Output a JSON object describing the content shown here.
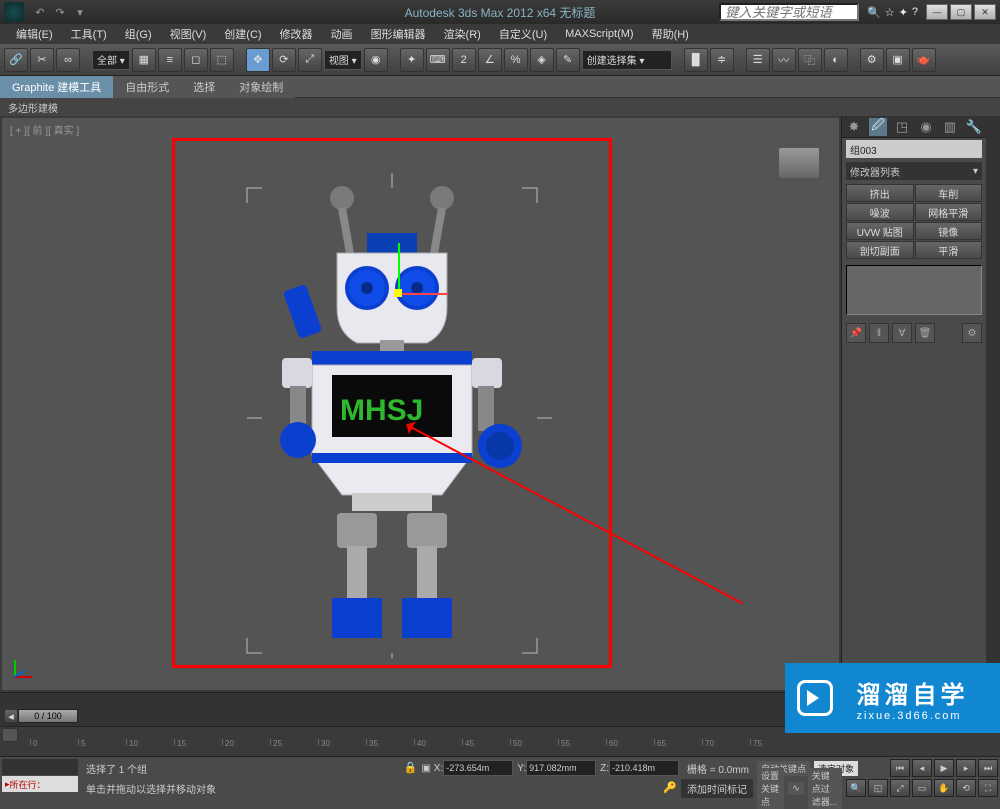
{
  "title": "Autodesk 3ds Max 2012 x64   无标题",
  "search_placeholder": "键入关键字或短语",
  "menu": [
    "编辑(E)",
    "工具(T)",
    "组(G)",
    "视图(V)",
    "创建(C)",
    "修改器",
    "动画",
    "图形编辑器",
    "渲染(R)",
    "自定义(U)",
    "MAXScript(M)",
    "帮助(H)"
  ],
  "toolbar": {
    "all_dropdown": "全部 ▾",
    "view_dropdown": "视图 ▾",
    "create_sel_set": "创建选择集 ▾"
  },
  "ribbon": {
    "modeling_tools": "Graphite 建模工具",
    "freeform": "自由形式",
    "select": "选择",
    "paint": "对象绘制",
    "poly": "多边形建模"
  },
  "viewport_label": "[ + ][ 前 ][ 真实 ]",
  "right": {
    "object_name": "组003",
    "modifier_list": "修改器列表",
    "buttons": [
      "挤出",
      "车削",
      "噪波",
      "网格平滑",
      "UVW 贴图",
      "镜像",
      "剖切副面",
      "平滑"
    ]
  },
  "time": {
    "slider": "0 / 100",
    "ticks": [
      0,
      5,
      10,
      15,
      20,
      25,
      30,
      35,
      40,
      45,
      50,
      55,
      60,
      65,
      70,
      75
    ]
  },
  "status": {
    "lock_label": "所在行：",
    "selection": "选择了 1 个组",
    "prompt": "单击并拖动以选择并移动对象",
    "x": "-273.654m",
    "y": "917.082mm",
    "z": "-210.418m",
    "grid": "栅格 = 0.0mm",
    "add_marker": "添加时间标记",
    "auto_key": "自动关键点",
    "sel_obj": "选定对象",
    "set_key": "设置关键点",
    "key_filter": "关键点过滤器..."
  },
  "watermark": {
    "big": "溜溜自学",
    "small": "zixue.3d66.com"
  }
}
